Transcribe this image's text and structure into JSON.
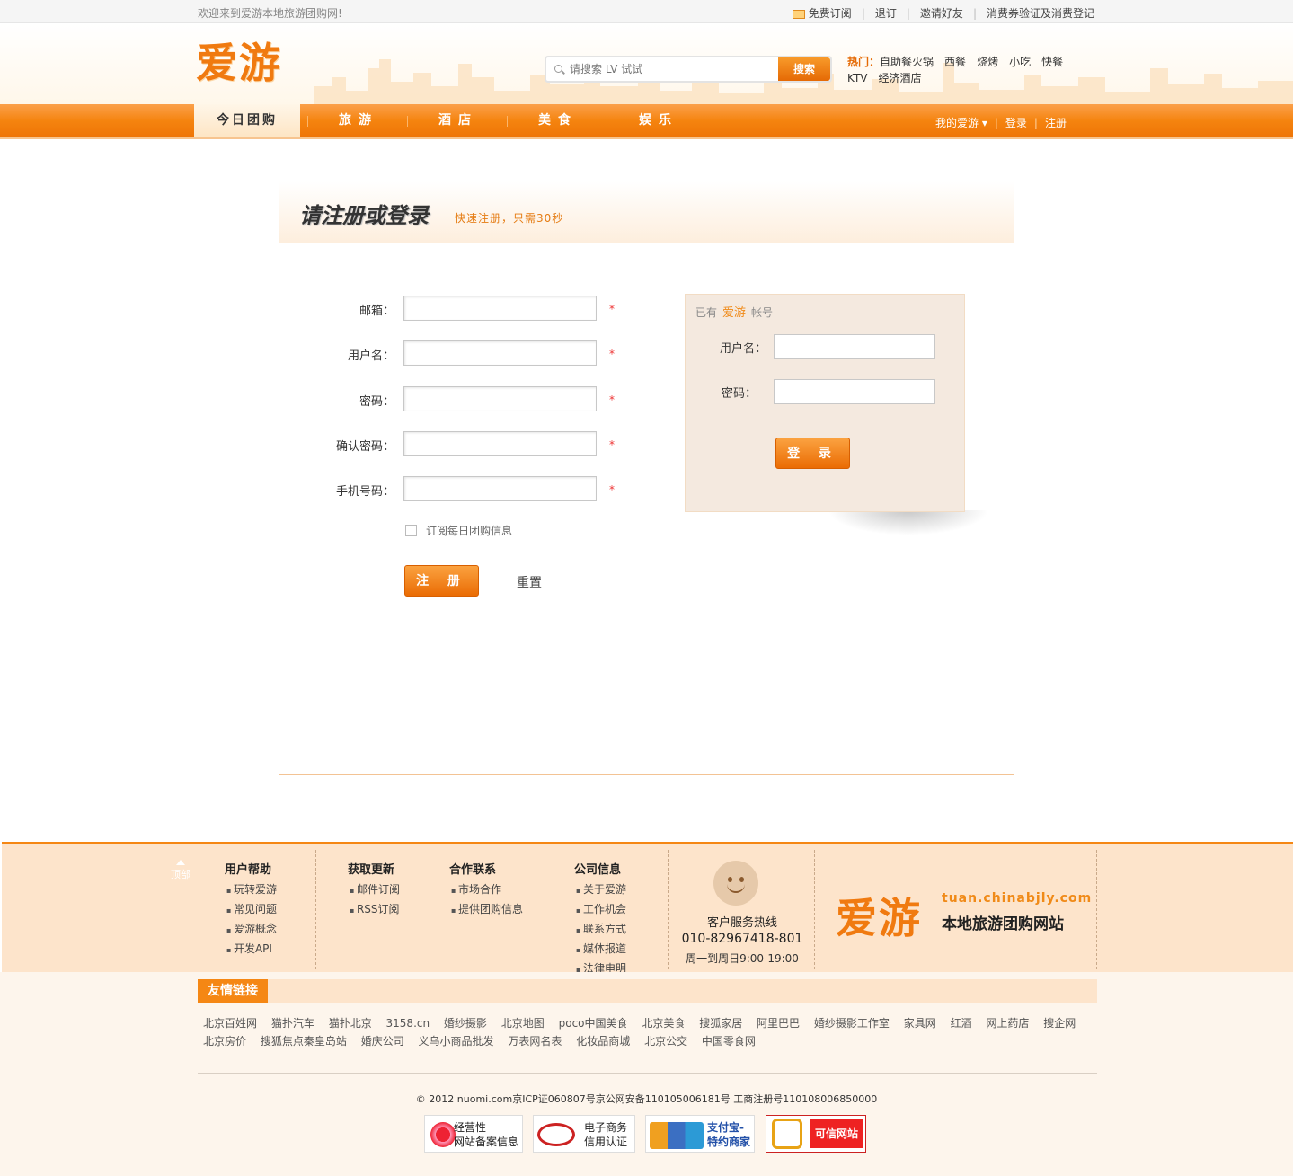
{
  "topbar": {
    "welcome": "欢迎来到爱游本地旅游团购网!",
    "links": [
      "免费订阅",
      "退订",
      "邀请好友",
      "消费券验证及消费登记"
    ]
  },
  "header": {
    "logo": "爱游",
    "search_placeholder": "请搜索 LV 试试",
    "search_button": "搜索",
    "hot_label": "热门：",
    "hot_keywords": [
      "自助餐",
      "火锅",
      "西餐",
      "烧烤",
      "小吃",
      "快餐",
      "KTV",
      "经济酒店"
    ]
  },
  "nav": {
    "items": [
      "今日团购",
      "旅游",
      "酒店",
      "美食",
      "娱乐"
    ],
    "active_index": 0,
    "right": {
      "my": "我的爱游",
      "login": "登录",
      "register": "注册"
    }
  },
  "register_box": {
    "title": "请注册或登录",
    "subtitle": "快速注册，只需30秒",
    "fields": [
      {
        "label": "邮箱：",
        "value": "",
        "required": "*"
      },
      {
        "label": "用户名：",
        "value": "",
        "required": "*"
      },
      {
        "label": "密码：",
        "value": "",
        "required": "*"
      },
      {
        "label": "确认密码：",
        "value": "",
        "required": "*"
      },
      {
        "label": "手机号码：",
        "value": "",
        "required": "*"
      }
    ],
    "subscribe_label": "订阅每日团购信息",
    "subscribe_checked": false,
    "register_button": "注 册",
    "reset_button": "重置"
  },
  "login_box": {
    "caption_prefix": "已有",
    "caption_brand": "爱游",
    "caption_suffix": "帐号",
    "username_label": "用户名：",
    "password_label": "密码：",
    "login_button": "登 录"
  },
  "footer": {
    "back_top": "顶部",
    "columns": [
      {
        "title": "用户帮助",
        "items": [
          "玩转爱游",
          "常见问题",
          "爱游概念",
          "开发API"
        ]
      },
      {
        "title": "获取更新",
        "items": [
          "邮件订阅",
          "RSS订阅"
        ]
      },
      {
        "title": "合作联系",
        "items": [
          "市场合作",
          "提供团购信息"
        ]
      },
      {
        "title": "公司信息",
        "items": [
          "关于爱游",
          "工作机会",
          "联系方式",
          "媒体报道",
          "法律申明"
        ]
      }
    ],
    "service_title": "客户服务热线",
    "service_phone": "010-82967418-801",
    "service_hours": "周一到周日9:00-19:00",
    "logo": "爱游",
    "domain": "tuan.chinabjly.com",
    "slogan": "本地旅游团购网站"
  },
  "friend_links": {
    "title": "友情链接",
    "links": [
      "北京百姓网",
      "猫扑汽车",
      "猫扑北京",
      "3158.cn",
      "婚纱摄影",
      "北京地图",
      "poco中国美食",
      "北京美食",
      "搜狐家居",
      "阿里巴巴",
      "婚纱摄影工作室",
      "家具网",
      "红酒",
      "网上药店",
      "搜企网",
      "北京房价",
      "搜狐焦点秦皇岛站",
      "婚庆公司",
      "义乌小商品批发",
      "万表网名表",
      "化妆品商城",
      "北京公交",
      "中国零食网"
    ]
  },
  "copyright": "© 2012 nuomi.com京ICP证060807号京公网安备110105006181号 工商注册号110108006850000",
  "badges": [
    {
      "line1": "经营性",
      "line2": "网站备案信息"
    },
    {
      "line1": "电子商务",
      "line2": "信用认证"
    },
    {
      "line1": "支付宝-",
      "line2": "特约商家"
    },
    {
      "line1": "可信网站",
      "line2": ""
    }
  ],
  "colors": {
    "accent": "#f58714",
    "nav_dark": "#ee7406",
    "footer_bg": "#fde4cb",
    "required": "#ee3333"
  }
}
